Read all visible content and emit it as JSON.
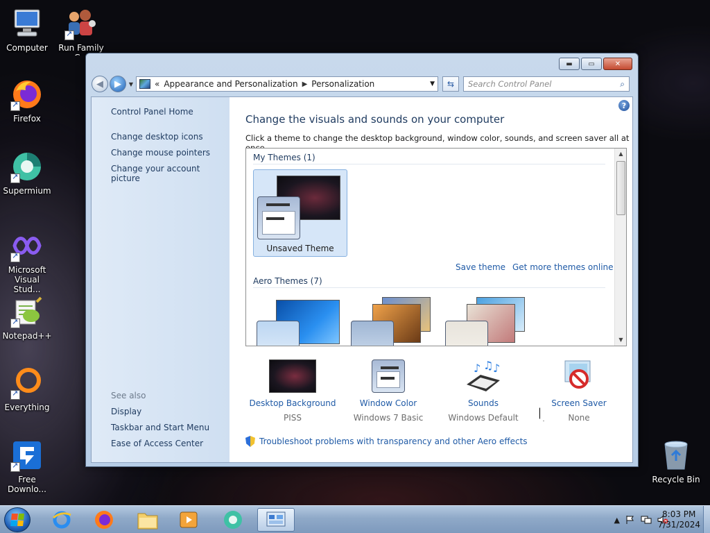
{
  "desktop": {
    "icons": [
      {
        "label": "Computer",
        "icon": "computer-icon"
      },
      {
        "label": "Run Family Gui",
        "icon": "family-icon"
      },
      {
        "label": "Firefox",
        "icon": "firefox-icon"
      },
      {
        "label": "Supermium",
        "icon": "supermium-icon"
      },
      {
        "label": "Microsoft Visual Stud...",
        "icon": "visual-studio-icon"
      },
      {
        "label": "Notepad++",
        "icon": "notepadpp-icon"
      },
      {
        "label": "Everything",
        "icon": "everything-icon"
      },
      {
        "label": "Free Downlo...",
        "icon": "free-download-icon"
      },
      {
        "label": "Recycle Bin",
        "icon": "recycle-bin-icon"
      }
    ]
  },
  "window": {
    "controls": {
      "minimize": "▬",
      "maximize": "▭",
      "close": "✕"
    },
    "address": {
      "prefix": "«",
      "crumb1": "Appearance and Personalization",
      "crumb2": "Personalization"
    },
    "search": {
      "placeholder": "Search Control Panel"
    }
  },
  "leftpane": {
    "home": "Control Panel Home",
    "links": [
      "Change desktop icons",
      "Change mouse pointers",
      "Change your account picture"
    ],
    "see_also": "See also",
    "see_also_links": [
      "Display",
      "Taskbar and Start Menu",
      "Ease of Access Center"
    ]
  },
  "main": {
    "title": "Change the visuals and sounds on your computer",
    "description": "Click a theme to change the desktop background, window color, sounds, and screen saver all at once.",
    "my_themes_head": "My Themes (1)",
    "unsaved_theme": "Unsaved Theme",
    "save_theme": "Save theme",
    "get_more": "Get more themes online",
    "aero_head": "Aero Themes (7)",
    "bottom": [
      {
        "label": "Desktop Background",
        "value": "PISS",
        "icon": "desktop-background-icon"
      },
      {
        "label": "Window Color",
        "value": "Windows 7 Basic",
        "icon": "window-color-icon"
      },
      {
        "label": "Sounds",
        "value": "Windows Default",
        "icon": "sounds-icon"
      },
      {
        "label": "Screen Saver",
        "value": "None",
        "icon": "screen-saver-icon"
      }
    ],
    "troubleshoot": "Troubleshoot problems with transparency and other Aero effects"
  },
  "taskbar": {
    "clock_time": "8:03 PM",
    "clock_date": "7/31/2024",
    "tray_chevron": "▲"
  }
}
